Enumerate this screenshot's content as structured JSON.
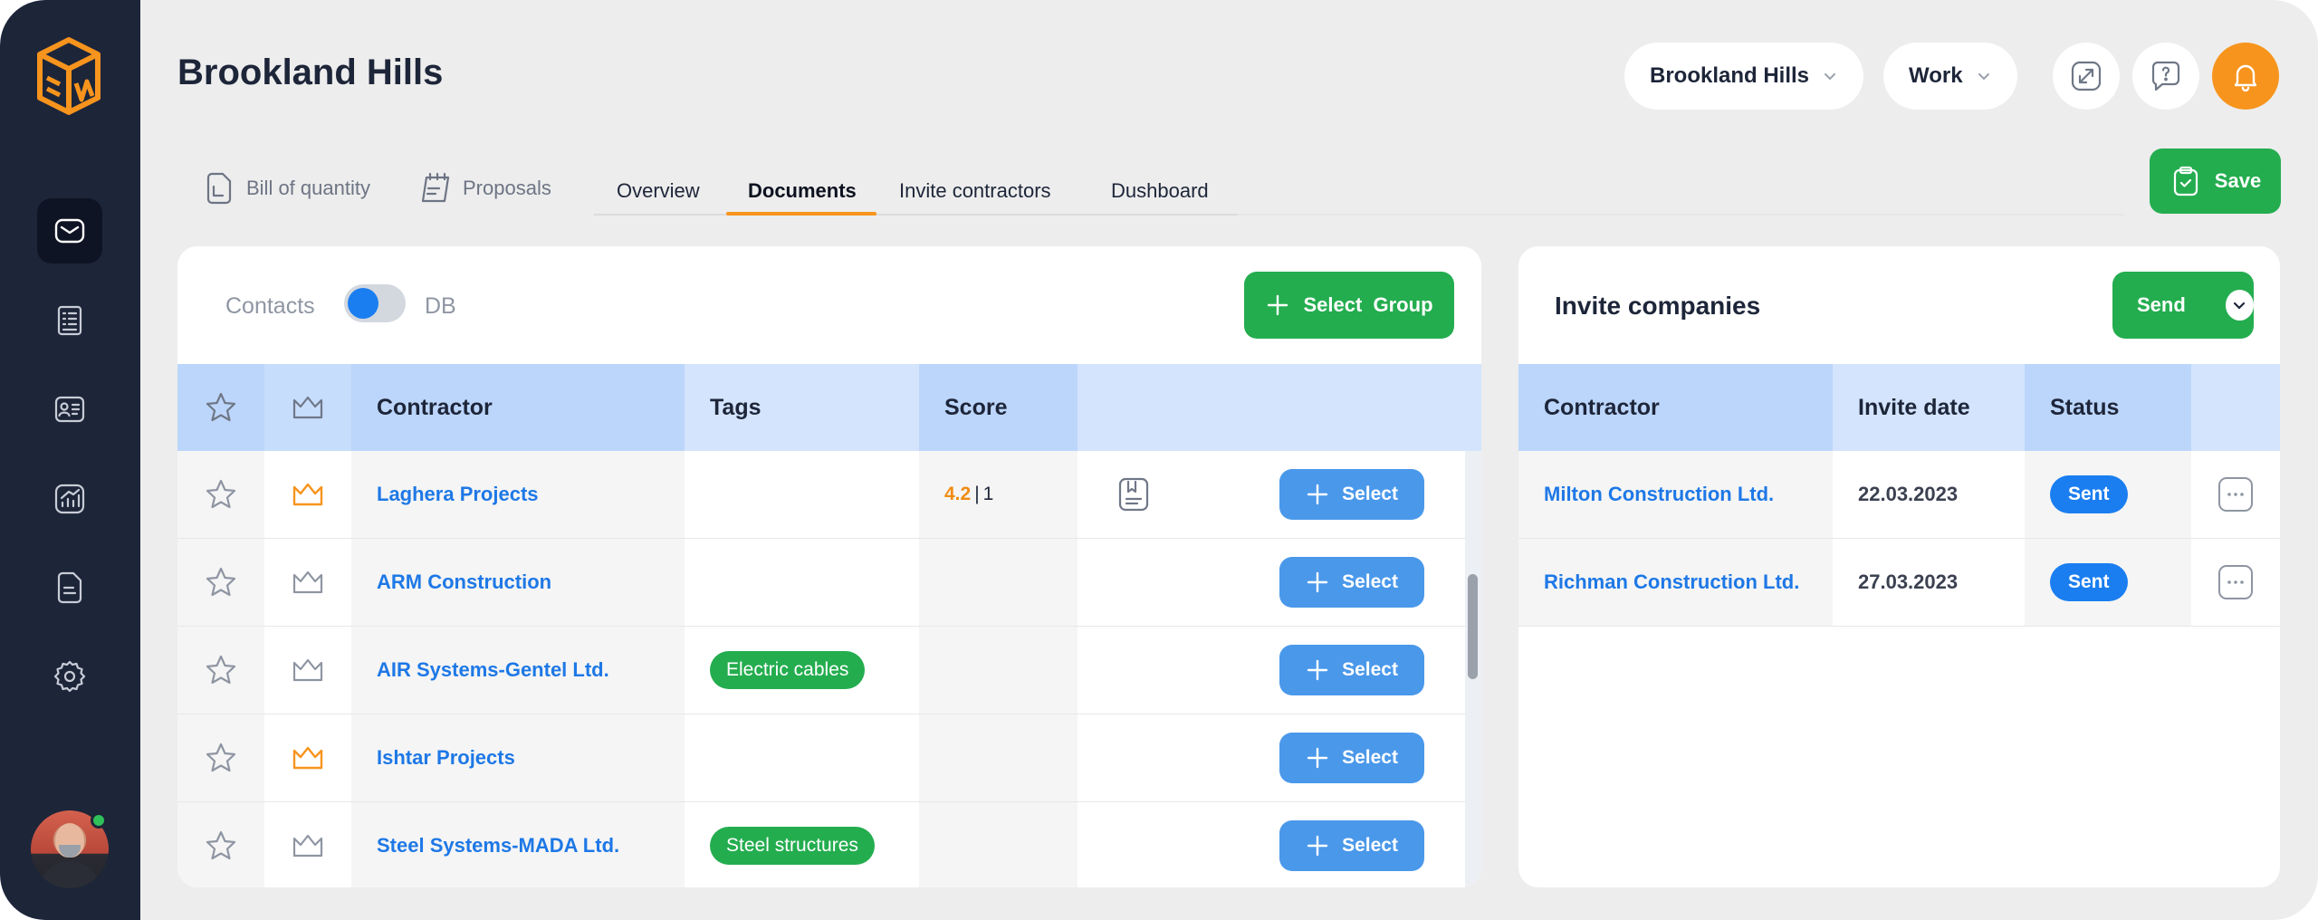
{
  "header": {
    "title": "Brookland Hills",
    "project_select": "Brookland Hills",
    "mode_select": "Work"
  },
  "colors": {
    "sidebar": "#1d2539",
    "accent_orange": "#f7941d",
    "primary_green": "#24ad4f",
    "link_blue": "#1e78e6",
    "status_blue": "#1a7ef0"
  },
  "tabs": {
    "icon_items": [
      "Bill of quantity",
      "Proposals"
    ],
    "items": [
      "Overview",
      "Documents",
      "Invite contractors",
      "Dushboard"
    ],
    "active": "Documents"
  },
  "save_label": "Save",
  "contractors_panel": {
    "toggle_left": "Contacts",
    "toggle_right": "DB",
    "select_group_label": "Select  Group",
    "columns": [
      "Contractor",
      "Tags",
      "Score"
    ],
    "rows": [
      {
        "name": "Laghera Projects",
        "tag": "",
        "score": "4.2",
        "score_count": "1",
        "crown": true,
        "doc": true
      },
      {
        "name": "ARM Construction",
        "tag": "",
        "score": "",
        "score_count": "",
        "crown": false,
        "doc": false
      },
      {
        "name": "AIR Systems-Gentel Ltd.",
        "tag": "Electric cables",
        "score": "",
        "score_count": "",
        "crown": false,
        "doc": false
      },
      {
        "name": "Ishtar Projects",
        "tag": "",
        "score": "",
        "score_count": "",
        "crown": true,
        "doc": false
      },
      {
        "name": "Steel Systems-MADA Ltd.",
        "tag": "Steel structures",
        "score": "",
        "score_count": "",
        "crown": false,
        "doc": false
      }
    ],
    "select_label": "Select"
  },
  "invite_panel": {
    "title": "Invite companies",
    "send_label": "Send",
    "columns": [
      "Contractor",
      "Invite date",
      "Status"
    ],
    "rows": [
      {
        "name": "Milton Construction Ltd.",
        "date": "22.03.2023",
        "status": "Sent"
      },
      {
        "name": "Richman Construction Ltd.",
        "date": "27.03.2023",
        "status": "Sent"
      }
    ]
  },
  "icons": {
    "sidebar": [
      "mail-icon",
      "list-icon",
      "contact-card-icon",
      "analytics-icon",
      "document-icon",
      "settings-icon"
    ],
    "header": [
      "expand-icon",
      "help-chat-icon",
      "bell-icon"
    ]
  }
}
